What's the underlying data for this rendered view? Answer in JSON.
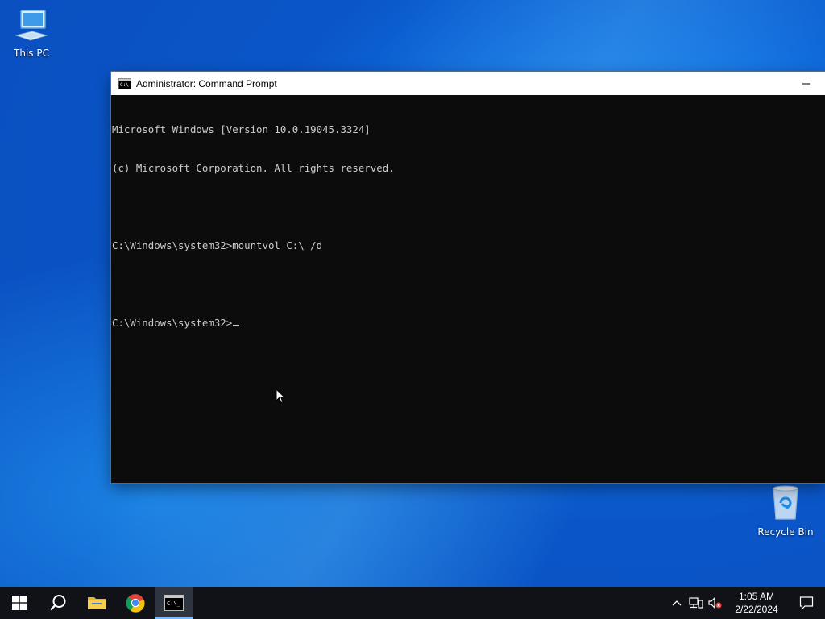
{
  "desktop": {
    "icons": [
      {
        "label": "This PC",
        "icon": "computer-icon"
      },
      {
        "label": "Recycle Bin",
        "icon": "recycle-bin-icon"
      }
    ]
  },
  "window": {
    "title": "Administrator: Command Prompt",
    "icon": "cmd-icon",
    "console_lines": [
      "Microsoft Windows [Version 10.0.19045.3324]",
      "(c) Microsoft Corporation. All rights reserved.",
      "",
      "C:\\Windows\\system32>mountvol C:\\ /d",
      "",
      "C:\\Windows\\system32>"
    ]
  },
  "taskbar": {
    "buttons": [
      {
        "name": "start",
        "icon": "windows-logo-icon"
      },
      {
        "name": "search",
        "icon": "search-icon"
      },
      {
        "name": "file-explorer",
        "icon": "folder-icon"
      },
      {
        "name": "chrome",
        "icon": "chrome-icon"
      },
      {
        "name": "command-prompt",
        "icon": "cmd-icon",
        "active": true
      }
    ],
    "tray": {
      "time": "1:05 AM",
      "date": "2/22/2024"
    }
  },
  "colors": {
    "console_bg": "#0c0c0c",
    "console_fg": "#cccccc",
    "taskbar_bg": "#101218",
    "active_indicator": "#7ab8ff"
  }
}
